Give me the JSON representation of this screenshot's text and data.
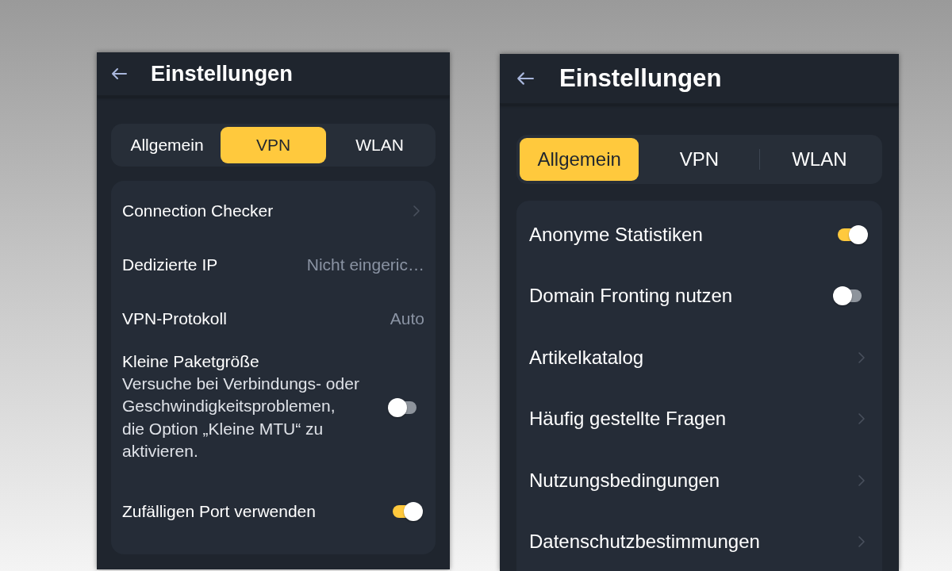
{
  "screens": [
    {
      "title": "Einstellungen",
      "tabs": [
        {
          "label": "Allgemein",
          "selected": false
        },
        {
          "label": "VPN",
          "selected": true
        },
        {
          "label": "WLAN",
          "selected": false
        }
      ],
      "rows": [
        {
          "kind": "link",
          "label": "Connection Checker"
        },
        {
          "kind": "value",
          "label": "Dedizierte IP",
          "value": "Nicht eingeric…"
        },
        {
          "kind": "value",
          "label": "VPN-Protokoll",
          "value": "Auto"
        },
        {
          "kind": "toggle",
          "label": "Kleine Paketgröße",
          "description": "Versuche bei Verbindungs- oder Geschwindigkeitsproblemen, die Option „Kleine MTU“ zu aktivieren.",
          "on": false
        },
        {
          "kind": "toggle",
          "label": "Zufälligen Port verwenden",
          "on": true
        }
      ]
    },
    {
      "title": "Einstellungen",
      "tabs": [
        {
          "label": "Allgemein",
          "selected": true
        },
        {
          "label": "VPN",
          "selected": false
        },
        {
          "label": "WLAN",
          "selected": false
        }
      ],
      "rows": [
        {
          "kind": "toggle",
          "label": "Anonyme Statistiken",
          "on": true
        },
        {
          "kind": "toggle",
          "label": "Domain Fronting nutzen",
          "on": false
        },
        {
          "kind": "link",
          "label": "Artikelkatalog"
        },
        {
          "kind": "link",
          "label": "Häufig gestellte Fragen"
        },
        {
          "kind": "link",
          "label": "Nutzungsbedingungen"
        },
        {
          "kind": "link",
          "label": "Datenschutzbestimmungen"
        }
      ]
    }
  ]
}
